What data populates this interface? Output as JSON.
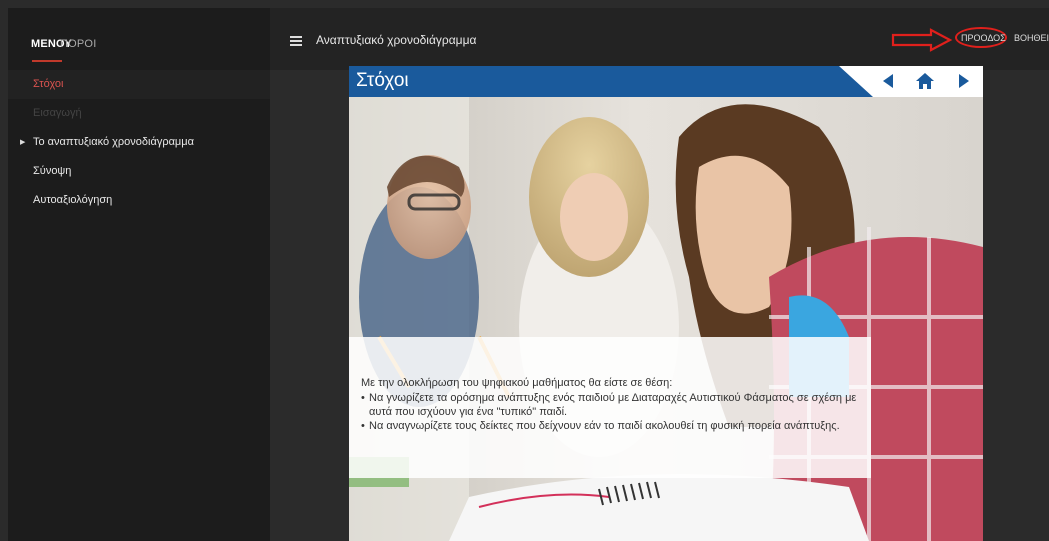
{
  "sidebar": {
    "tabs": [
      {
        "label": "ΜΕΝΟΥ",
        "active": true
      },
      {
        "label": "ΠΟΡΟΙ",
        "active": false
      }
    ],
    "items": [
      {
        "label": "Στόχοι",
        "state": "selected"
      },
      {
        "label": "Εισαγωγή",
        "state": "disabled"
      },
      {
        "label": "Το αναπτυξιακό χρονοδιάγραμμα",
        "state": "normal",
        "expandable": true
      },
      {
        "label": "Σύνοψη",
        "state": "normal"
      },
      {
        "label": "Αυτοαξιολόγηση",
        "state": "normal"
      }
    ]
  },
  "header": {
    "title": "Αναπτυξιακό χρονοδιάγραμμα",
    "progress_label": "ΠΡΟΟΔΟΣ",
    "help_label": "ΒΟΗΘΕΙΑ",
    "menu_icon": "hamburger-icon"
  },
  "panel": {
    "title": "Στόχοι",
    "nav": {
      "prev_icon": "triangle-left-icon",
      "home_icon": "home-icon",
      "next_icon": "triangle-right-icon"
    },
    "intro": "Με την ολοκλήρωση του ψηφιακού μαθήματος θα είστε σε θέση:",
    "goals": [
      "Να γνωρίζετε τα ορόσημα ανάπτυξης ενός παιδιού με Διαταραχές Αυτιστικού Φάσματος σε σχέση με αυτά που ισχύουν για ένα \"τυπικό\" παιδί.",
      "Να αναγνωρίζετε τους δείκτες που δείχνουν εάν το παιδί ακολουθεί τη φυσική πορεία ανάπτυξης."
    ]
  },
  "colors": {
    "accent_red": "#d9534f",
    "panel_blue": "#1a5a9c",
    "annotation_red": "#e0201c"
  }
}
